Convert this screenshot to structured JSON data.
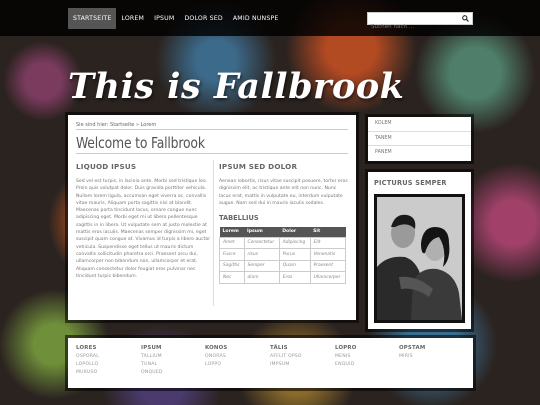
{
  "nav": {
    "items": [
      "STARTSEITE",
      "LOREM",
      "IPSUM",
      "DOLOR SED",
      "AMID NUNSPE"
    ],
    "active_index": 0
  },
  "search": {
    "placeholder": "Suchen nach ..."
  },
  "site_title": "This is Fallbrook",
  "breadcrumb": "Sie sind hier: Startseite » Lorem",
  "page_title": "Welcome to Fallbrook",
  "left_column": {
    "heading": "LIQUOD IPSUS",
    "text": "Sed vel est turpis, in lacinia ante. Morbi sed tristique leo. Proin quis volutpat dolor. Duis gravida porttitor vehicula. Nullam lorem ligula, accumsan eget viverra ac, convallis vitae mauris. Aliquam porta sagittis nisi at blandit. Maecenas porta tincidunt lacus, ornare congue nunc adipiscing eget. Morbi eget mi ut libero pellentesque sagittis in in libero. Ut vulputate sem at justo molestie at mattis eros iaculis. Maecenas semper dignissim mi, eget suscipit quam congue at. Vivamus id turpis a libero auctor vehicula. Suspendisse eget tellus ut mauris dictum convallis sollicitudin pharetra orci. Praesent arcu dui, ullamcorper non bibendum non, ullamcorper et erat. Aliquam consectetur dolor feugiat eros pulvinar nec tincidunt turpis bibendum."
  },
  "right_column": {
    "heading": "IPSUM SED DOLOR",
    "text": "Aenean lobortis, risus vitae suscipit posuere, tortor eros dignissim elit, ac tristique ante elit non nunc. Nunc lacus erat, mattis in vulputate eu, interdum vulputate augue. Nam sed dui in mauris iaculis sodales.",
    "table_heading": "TABELLIUS",
    "table": {
      "headers": [
        "Lorem",
        "Ipsum",
        "Dolor",
        "Sit"
      ],
      "rows": [
        [
          "Amet",
          "Consectetur",
          "Adipiscing",
          "Elit"
        ],
        [
          "Fusce",
          "risus",
          "Purus",
          "Venenatis"
        ],
        [
          "Sagittis",
          "Semper",
          "Quam",
          "Praesent"
        ],
        [
          "Nec",
          "diam",
          "Eros",
          "Ullamcorper"
        ]
      ]
    }
  },
  "sidebar": {
    "links": [
      "KOLEM",
      "TANEM",
      "PANEM"
    ],
    "widget_title": "PICTURUS SEMPER"
  },
  "footer": {
    "columns": [
      {
        "heading": "LORES",
        "links": [
          "OSPORAL",
          "LOPOLLO",
          "MUKUSO"
        ]
      },
      {
        "heading": "IPSUM",
        "links": [
          "TALLIUM",
          "TUNAL",
          "ONQUED"
        ]
      },
      {
        "heading": "KONOS",
        "links": [
          "ONORAS",
          "LOPPO"
        ]
      },
      {
        "heading": "TÄLIS",
        "links": [
          "AFFLIT OPSO",
          "IMPSUM"
        ]
      },
      {
        "heading": "LOPRO",
        "links": [
          "MENIS",
          "ENQUID"
        ]
      },
      {
        "heading": "OPSTAM",
        "links": [
          "MIRIS"
        ]
      }
    ]
  }
}
